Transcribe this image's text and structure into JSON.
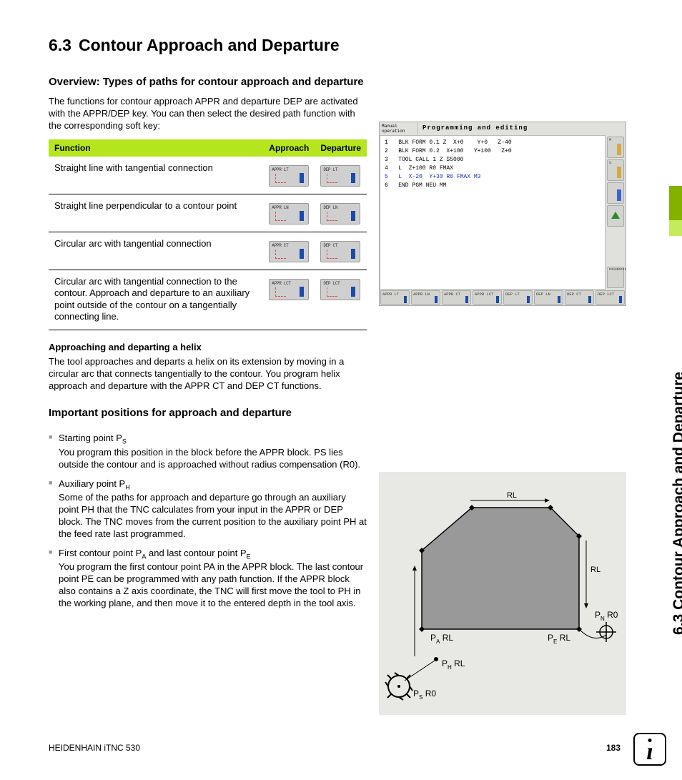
{
  "section": {
    "number": "6.3",
    "title": "Contour Approach and Departure"
  },
  "overview": {
    "heading": "Overview: Types of paths for contour approach and departure",
    "paragraph": "The functions for contour approach APPR and departure DEP are activated with the APPR/DEP key. You can then select the desired path function with the corresponding soft key:"
  },
  "table": {
    "headers": {
      "func": "Function",
      "appr": "Approach",
      "dep": "Departure"
    },
    "rows": [
      {
        "func": "Straight line with tangential connection",
        "appr": "APPR LT",
        "dep": "DEP LT"
      },
      {
        "func": "Straight line perpendicular to a contour point",
        "appr": "APPR LN",
        "dep": "DEP LN"
      },
      {
        "func": "Circular arc with tangential connection",
        "appr": "APPR CT",
        "dep": "DEP CT"
      },
      {
        "func": "Circular arc with tangential connection to the contour. Approach and departure to an auxiliary point outside of the contour on a tangentially connecting line.",
        "appr": "APPR LCT",
        "dep": "DEP LCT"
      }
    ]
  },
  "helix": {
    "heading": "Approaching and departing a helix",
    "paragraph": "The tool approaches and departs a helix on its extension by moving in a circular arc that connects tangentially to the contour. You program helix approach and departure with the APPR CT and DEP CT functions."
  },
  "positions": {
    "heading": "Important positions for approach and departure",
    "items": [
      {
        "lead": "Starting point P",
        "sub": "S",
        "text": "You program this position in the block before the APPR block. PS lies outside the contour and is approached without radius compensation (R0)."
      },
      {
        "lead": "Auxiliary point P",
        "sub": "H",
        "text": "Some of the paths for approach and departure go through an auxiliary point PH that the TNC calculates from your input in the APPR or DEP block. The TNC moves from the current position to the auxiliary point PH at the feed rate last programmed."
      },
      {
        "lead": "First contour point P",
        "sub": "A",
        "lead2": " and last contour point P",
        "sub2": "E",
        "text": "You program the first contour point PA in the APPR block. The last contour point PE can be programmed with any path function. If the APPR block also contains a Z axis coordinate, the TNC will first move the tool to PH in the working plane, and then move it to the entered depth in the tool axis."
      }
    ]
  },
  "cnc": {
    "mode": "Manual operation",
    "title": "Programming and editing",
    "code": [
      "1   BLK FORM 0.1 Z  X+0    Y+0   Z-40",
      "2   BLK FORM 0.2  X+100   Y+100   Z+0",
      "3   TOOL CALL 1 Z S5000",
      "4   L  Z+100 R0 FMAX",
      "5   L  X-20  Y+30 R0 FMAX M3",
      "6   END PGM NEU MM"
    ],
    "highlight_index": 4,
    "sidebar_diag": "DIAGNOSIS",
    "softkeys": [
      "APPR LT",
      "APPR LN",
      "APPR CT",
      "APPR LCT",
      "DEP LT",
      "DEP LN",
      "DEP CT",
      "DEP LCT"
    ]
  },
  "diagram_labels": {
    "rl_top": "RL",
    "rl_right": "RL",
    "pa": "P",
    "pa_sub": "A",
    "pa_suf": " RL",
    "pe": "P",
    "pe_sub": "E",
    "pe_suf": " RL",
    "ph": "P",
    "ph_sub": "H",
    "ph_suf": " RL",
    "ps": "P",
    "ps_sub": "S",
    "ps_suf": " R0",
    "pn": "P",
    "pn_sub": "N",
    "pn_suf": " R0"
  },
  "side_tab": "6.3 Contour Approach and Departure",
  "footer": {
    "left": "HEIDENHAIN iTNC 530",
    "page": "183"
  }
}
